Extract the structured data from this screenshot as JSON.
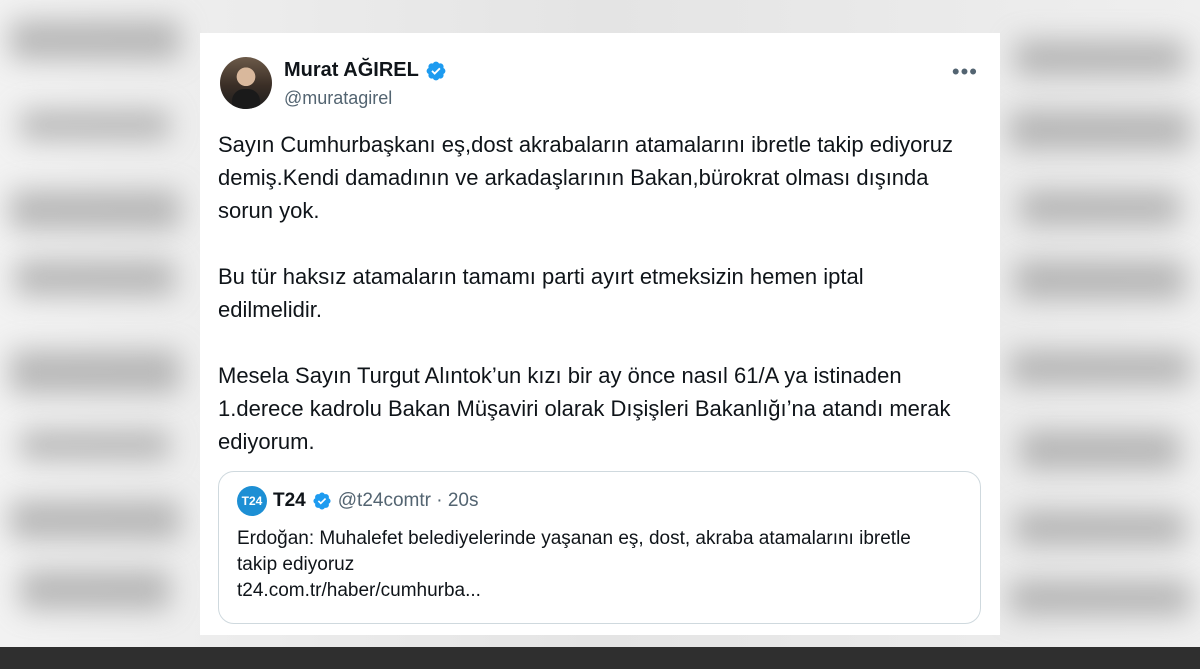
{
  "tweet": {
    "author_name": "Murat AĞIREL",
    "author_handle": "@muratagirel",
    "more_label": "•••",
    "paragraphs": [
      "Sayın Cumhurbaşkanı eş,dost akrabaların atamalarını ibretle takip ediyoruz demiş.Kendi damadının ve arkadaşlarının Bakan,bürokrat olması dışında sorun yok.",
      "Bu tür haksız atamaların tamamı parti ayırt etmeksizin hemen iptal edilmelidir.",
      "Mesela Sayın Turgut Alıntok’un kızı bir ay önce nasıl 61/A ya istinaden 1.derece kadrolu Bakan Müşaviri olarak Dışişleri Bakanlığı’na atandı merak ediyorum."
    ]
  },
  "quote": {
    "logo_text": "T24",
    "name": "T24",
    "handle_time": "@t24comtr · 20s",
    "text": "Erdoğan: Muhalefet belediyelerinde yaşanan eş, dost, akraba atamalarını ibretle takip ediyoruz",
    "link": "t24.com.tr/haber/cumhurba..."
  },
  "colors": {
    "verified": "#1d9bf0",
    "text": "#0f1419",
    "muted": "#536471"
  },
  "icons": {
    "verified": "verified-badge-icon",
    "more": "more-options-icon"
  }
}
